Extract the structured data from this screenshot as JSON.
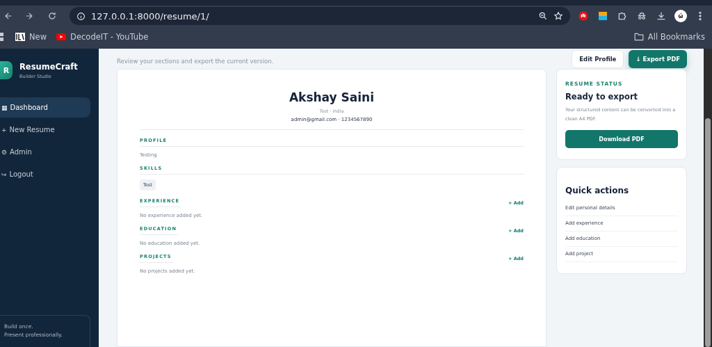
{
  "browser": {
    "url": "127.0.0.1:8000/resume/1/",
    "bookmarks": [
      {
        "label": "New",
        "kind": "page"
      },
      {
        "label": "DecodeIT - YouTube",
        "kind": "video"
      }
    ],
    "all_bookmarks": "All Bookmarks",
    "profile": "ώ"
  },
  "sidebar": {
    "brand": {
      "logo": "R",
      "name": "ResumeCraft",
      "tagline": "Builder Studio"
    },
    "items": [
      {
        "icon": "▦",
        "label": "Dashboard",
        "selected": true
      },
      {
        "icon": "+",
        "label": "New Resume",
        "selected": false
      },
      {
        "icon": "⚙",
        "label": "Admin",
        "selected": false
      },
      {
        "icon": "↪",
        "label": "Logout",
        "selected": false
      }
    ],
    "footer": [
      "Build once.",
      "Present professionally."
    ]
  },
  "header": {
    "subtitle": "Review your sections and export the current version.",
    "buttons": [
      {
        "label": "Edit Profile",
        "kind": "secondary"
      },
      {
        "label": "↓ Export PDF",
        "kind": "primary"
      }
    ]
  },
  "resume": {
    "name": "Akshay Saini",
    "location": "Test · India",
    "contact": "admin@gmail.com · 1234567890",
    "sections": [
      {
        "title": "PROFILE",
        "kind": "text",
        "text": "Testing"
      },
      {
        "title": "SKILLS",
        "kind": "tags",
        "tags": [
          "Test"
        ]
      },
      {
        "title": "EXPERIENCE",
        "kind": "empty",
        "text": "No experience added yet.",
        "action": "+ Add"
      },
      {
        "title": "EDUCATION",
        "kind": "empty",
        "text": "No education added yet.",
        "action": "+ Add"
      },
      {
        "title": "PROJECTS",
        "kind": "empty",
        "text": "No projects added yet.",
        "action": "+ Add"
      }
    ]
  },
  "status_card": {
    "eyebrow": "RESUME STATUS",
    "title": "Ready to export",
    "text": "Your structured content can be converted into a clean A4 PDF.",
    "button": "Download PDF"
  },
  "quick_actions": {
    "title": "Quick actions",
    "items": [
      "Edit personal details",
      "Add experience",
      "Add education",
      "Add project"
    ]
  }
}
